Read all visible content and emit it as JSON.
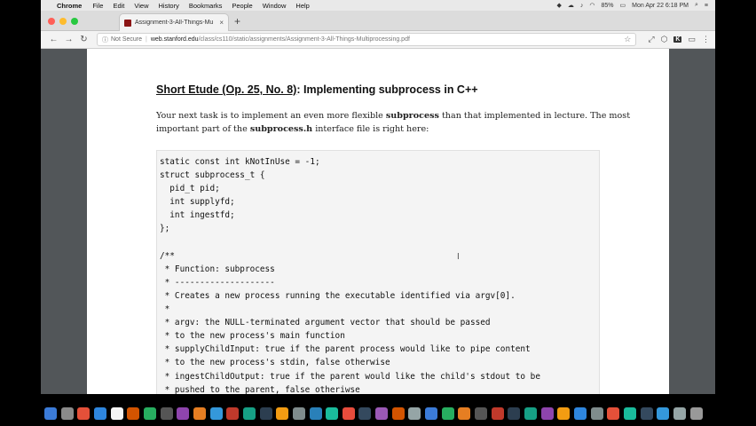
{
  "menubar": {
    "app_name": "Chrome",
    "items": [
      "File",
      "Edit",
      "View",
      "History",
      "Bookmarks",
      "People",
      "Window",
      "Help"
    ],
    "battery": "85%",
    "datetime": "Mon Apr 22  6:18 PM"
  },
  "tab": {
    "title": "Assignment-3-All-Things-Mu",
    "close": "×"
  },
  "newtab": "+",
  "address": {
    "info": "ⓘ",
    "security": "Not Secure",
    "separator": "|",
    "host": "web.stanford.edu",
    "path": "/class/cs110/static/assignments/Assignment-3-All-Things-Multiprocessing.pdf"
  },
  "document": {
    "heading_link": "Short Etude (Op. 25, No. 8)",
    "heading_rest": ": Implementing subprocess in C++",
    "para": {
      "p1": "Your next task is to implement an even more flexible ",
      "b1": "subprocess",
      "p2": " than that implemented in lecture.  The most important part of the ",
      "b2": "subprocess.h",
      "p3": " interface file is right here:"
    },
    "code_lines": [
      "static const int kNotInUse = -1;",
      "struct subprocess_t {",
      "  pid_t pid;",
      "  int supplyfd;",
      "  int ingestfd;",
      "};",
      "",
      "/**",
      " * Function: subprocess",
      " * --------------------",
      " * Creates a new process running the executable identified via argv[0].",
      " *",
      " * argv: the NULL-terminated argument vector that should be passed",
      " * to the new process's main function",
      " * supplyChildInput: true if the parent process would like to pipe content",
      " * to the new process's stdin, false otherwise",
      " * ingestChildOutput: true if the parent would like the child's stdout to be",
      " * pushed to the parent, false otheriwse",
      " */"
    ]
  },
  "dock_colors": [
    "#3b7bd8",
    "#8a8a8a",
    "#e55039",
    "#2e86de",
    "#f5f5f5",
    "#d35400",
    "#27ae60",
    "#555",
    "#8e44ad",
    "#e67e22",
    "#3498db",
    "#c0392b",
    "#16a085",
    "#2c3e50",
    "#f39c12",
    "#7f8c8d",
    "#2980b9",
    "#1abc9c",
    "#e74c3c",
    "#34495e",
    "#9b59b6",
    "#d35400",
    "#95a5a6",
    "#3b7bd8",
    "#27ae60",
    "#e67e22",
    "#555",
    "#c0392b",
    "#2c3e50",
    "#16a085",
    "#8e44ad",
    "#f39c12",
    "#2e86de",
    "#7f8c8d",
    "#e55039",
    "#1abc9c",
    "#34495e",
    "#3498db",
    "#95a5a6",
    "#999"
  ]
}
